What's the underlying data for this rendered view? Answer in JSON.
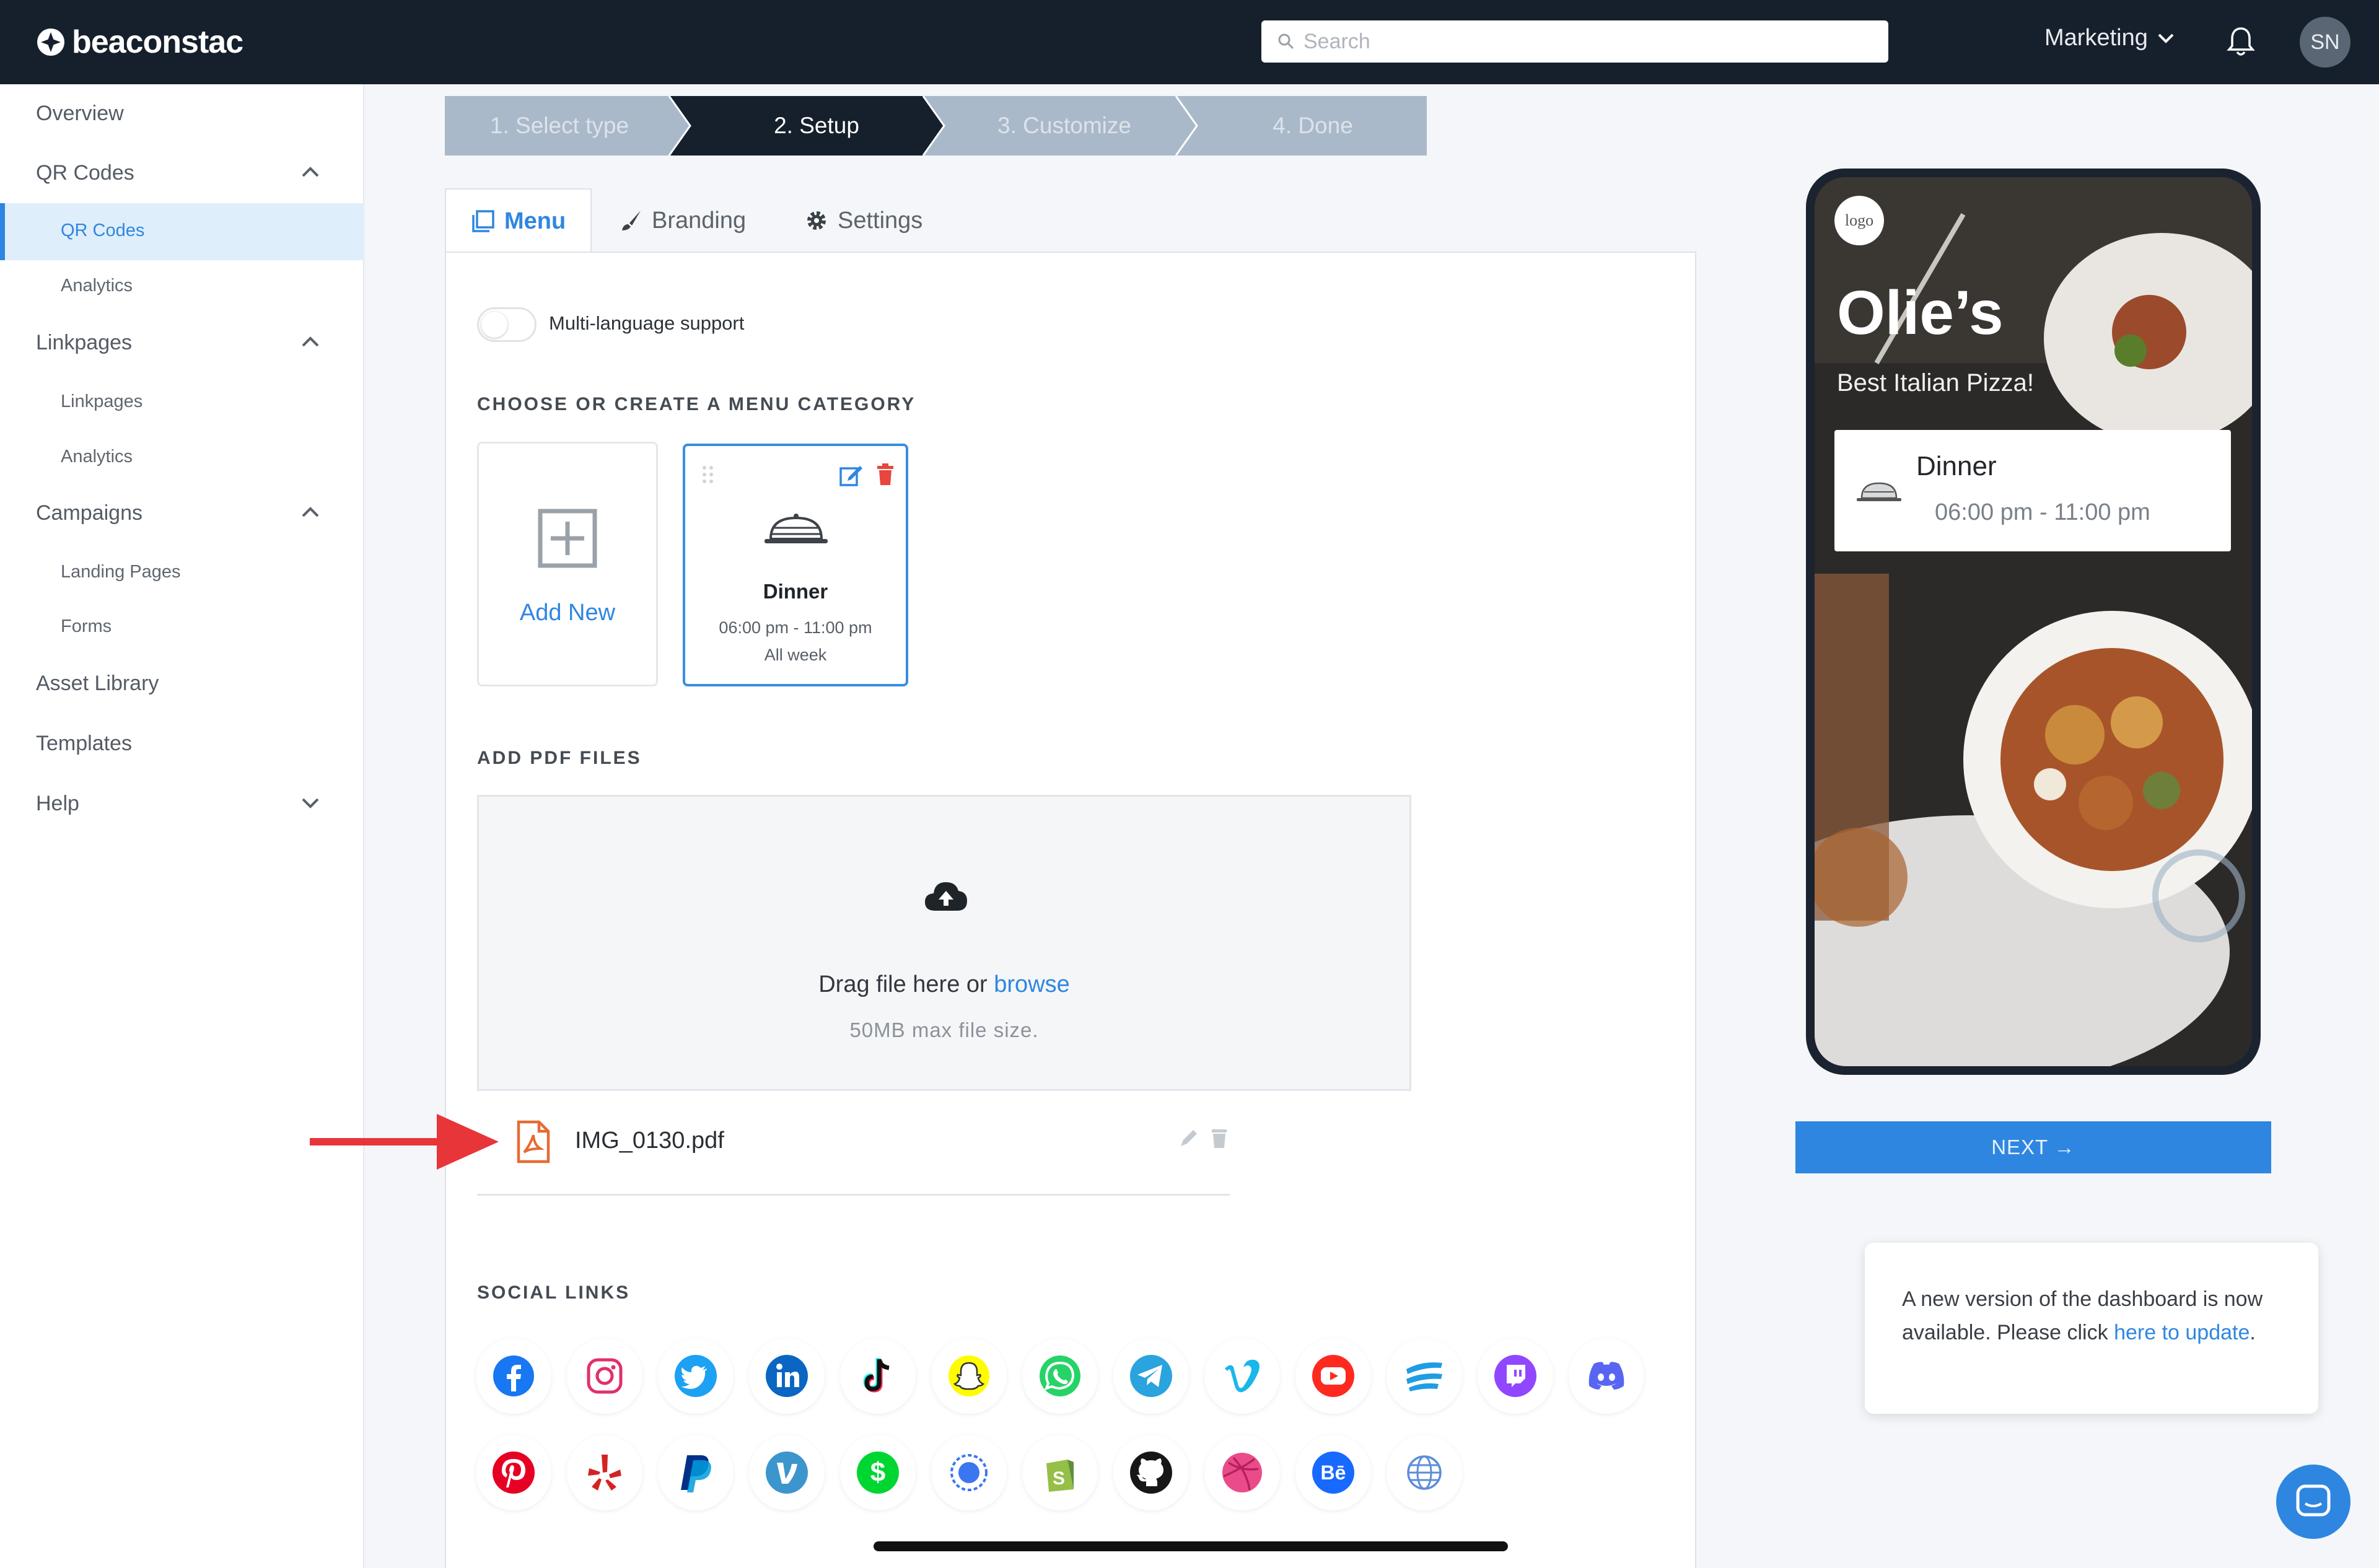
{
  "header": {
    "logo_text": "beaconstac",
    "search_placeholder": "Search",
    "workspace": "Marketing",
    "avatar_initials": "SN"
  },
  "sidebar": {
    "overview": "Overview",
    "qr_codes": "QR Codes",
    "qr_codes_sub": "QR Codes",
    "qr_analytics": "Analytics",
    "linkpages": "Linkpages",
    "linkpages_sub": "Linkpages",
    "linkpages_analytics": "Analytics",
    "campaigns": "Campaigns",
    "landing_pages": "Landing Pages",
    "forms": "Forms",
    "asset_library": "Asset Library",
    "templates": "Templates",
    "help": "Help"
  },
  "steps": [
    "1. Select type",
    "2. Setup",
    "3. Customize",
    "4. Done"
  ],
  "tabs": {
    "menu": "Menu",
    "branding": "Branding",
    "settings": "Settings"
  },
  "menu_form": {
    "multilang_label": "Multi-language support",
    "category_heading": "CHOOSE OR CREATE A MENU CATEGORY",
    "add_new": "Add New",
    "category": {
      "name": "Dinner",
      "time": "06:00 pm - 11:00 pm",
      "days": "All week"
    },
    "pdf_heading": "ADD PDF FILES",
    "drag_text": "Drag file here or",
    "browse": "browse",
    "max_size": "50MB max file size.",
    "file_name": "IMG_0130.pdf",
    "social_heading": "SOCIAL LINKS"
  },
  "social_icons": [
    "facebook-icon",
    "instagram-icon",
    "twitter-icon",
    "linkedin-icon",
    "tiktok-icon",
    "snapchat-icon",
    "whatsapp-icon",
    "telegram-icon",
    "vimeo-icon",
    "youtube-icon",
    "wattpad-icon",
    "twitch-icon",
    "discord-icon",
    "pinterest-icon",
    "yelp-icon",
    "paypal-icon",
    "venmo-icon",
    "cashapp-icon",
    "signal-icon",
    "shopify-icon",
    "github-icon",
    "dribbble-icon",
    "behance-icon",
    "website-icon"
  ],
  "preview": {
    "logo_label": "logo",
    "title": "Olie’s",
    "subtitle": "Best Italian Pizza!",
    "card_title": "Dinner",
    "card_time": "06:00 pm - 11:00 pm"
  },
  "next_button": "NEXT →",
  "notice": {
    "text": "A new version of the dashboard is now available. Please click",
    "link": "here to update",
    "end": "."
  },
  "colors": {
    "accent": "#2f86e0",
    "topbar": "#16202c",
    "danger": "#e8453c",
    "arrow": "#e8353a"
  }
}
